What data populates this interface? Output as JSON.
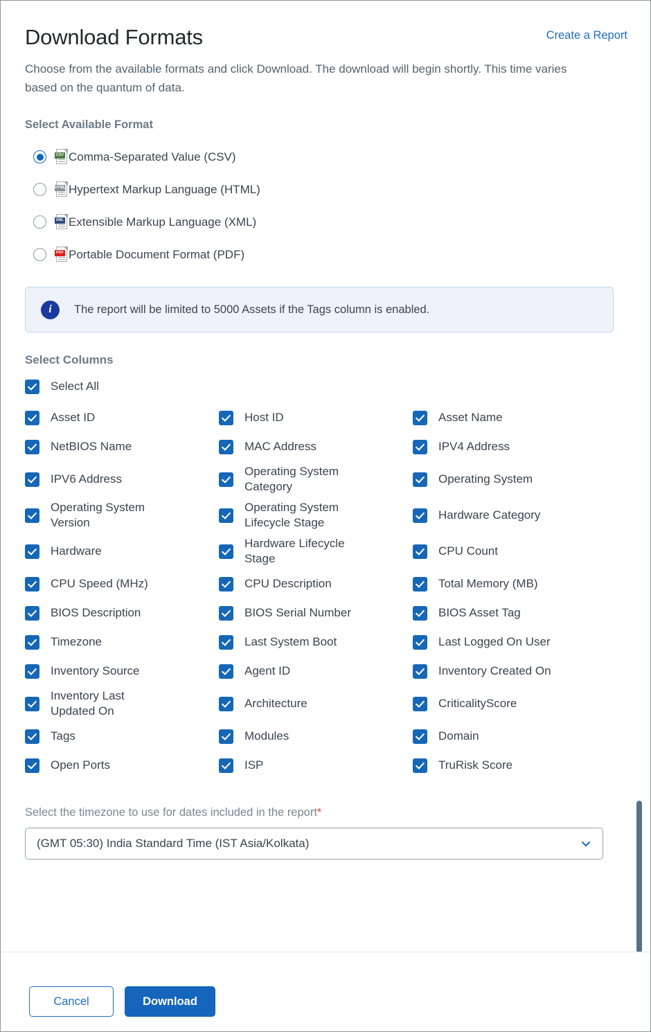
{
  "header": {
    "title": "Download Formats",
    "create_report_link": "Create a Report",
    "subtitle": "Choose from the available formats and click Download. The download will begin shortly. This time varies based on the quantum of data."
  },
  "format_section": {
    "heading": "Select Available Format",
    "selected": "csv",
    "options": [
      {
        "id": "csv",
        "label": "Comma-Separated Value (CSV)",
        "badge": "CSV",
        "badge_color": "#4b7a3f",
        "selected": true
      },
      {
        "id": "html",
        "label": "Hypertext Markup Language (HTML)",
        "badge": "HTML",
        "badge_color": "#8a9199",
        "selected": false
      },
      {
        "id": "xml",
        "label": "Extensible Markup Language (XML)",
        "badge": "XML",
        "badge_color": "#2e4a77",
        "selected": false
      },
      {
        "id": "pdf",
        "label": "Portable Document Format (PDF)",
        "badge": "PDF",
        "badge_color": "#e01b1b",
        "selected": false
      }
    ]
  },
  "info_banner": {
    "icon": "info-icon",
    "text": "The report will be limited to 5000 Assets if the Tags column is enabled.",
    "background": "#eef3fb",
    "border": "#c3d4ea"
  },
  "columns_section": {
    "heading": "Select Columns",
    "select_all": {
      "label": "Select All",
      "checked": true
    },
    "rows": [
      [
        {
          "label": "Asset ID",
          "checked": true
        },
        {
          "label": "Host ID",
          "checked": true
        },
        {
          "label": "Asset Name",
          "checked": true
        }
      ],
      [
        {
          "label": "NetBIOS Name",
          "checked": true
        },
        {
          "label": "MAC Address",
          "checked": true
        },
        {
          "label": "IPV4 Address",
          "checked": true
        }
      ],
      [
        {
          "label": "IPV6 Address",
          "checked": true
        },
        {
          "label": "Operating System Category",
          "checked": true
        },
        {
          "label": "Operating System",
          "checked": true
        }
      ],
      [
        {
          "label": "Operating System Version",
          "checked": true
        },
        {
          "label": "Operating System Lifecycle Stage",
          "checked": true
        },
        {
          "label": "Hardware Category",
          "checked": true
        }
      ],
      [
        {
          "label": "Hardware",
          "checked": true
        },
        {
          "label": "Hardware Lifecycle Stage",
          "checked": true
        },
        {
          "label": "CPU Count",
          "checked": true
        }
      ],
      [
        {
          "label": "CPU Speed (MHz)",
          "checked": true
        },
        {
          "label": "CPU Description",
          "checked": true
        },
        {
          "label": "Total Memory (MB)",
          "checked": true
        }
      ],
      [
        {
          "label": "BIOS Description",
          "checked": true
        },
        {
          "label": "BIOS Serial Number",
          "checked": true
        },
        {
          "label": "BIOS Asset Tag",
          "checked": true
        }
      ],
      [
        {
          "label": "Timezone",
          "checked": true
        },
        {
          "label": "Last System Boot",
          "checked": true
        },
        {
          "label": "Last Logged On User",
          "checked": true
        }
      ],
      [
        {
          "label": "Inventory Source",
          "checked": true
        },
        {
          "label": "Agent ID",
          "checked": true
        },
        {
          "label": "Inventory Created On",
          "checked": true
        }
      ],
      [
        {
          "label": "Inventory Last Updated On",
          "checked": true
        },
        {
          "label": "Architecture",
          "checked": true
        },
        {
          "label": "CriticalityScore",
          "checked": true
        }
      ],
      [
        {
          "label": "Tags",
          "checked": true
        },
        {
          "label": "Modules",
          "checked": true
        },
        {
          "label": "Domain",
          "checked": true
        }
      ],
      [
        {
          "label": "Open Ports",
          "checked": true
        },
        {
          "label": "ISP",
          "checked": true
        },
        {
          "label": "TruRisk Score",
          "checked": true
        }
      ]
    ]
  },
  "timezone_section": {
    "label": "Select the timezone to use for dates included in the report",
    "required_marker": "*",
    "selected_value": "(GMT 05:30) India Standard Time (IST Asia/Kolkata)"
  },
  "footer": {
    "cancel_label": "Cancel",
    "download_label": "Download"
  },
  "colors": {
    "accent": "#1465bb",
    "link": "#1f6cc4",
    "checkbox": "#1667b6",
    "scrollbar": "#567287",
    "heading_muted": "#6b7a88"
  }
}
